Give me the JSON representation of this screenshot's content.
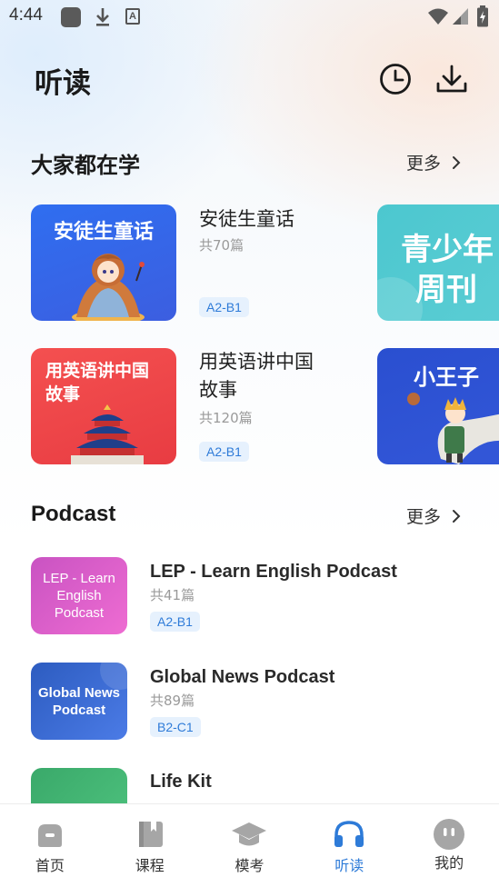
{
  "status_bar": {
    "time": "4:44",
    "icons": [
      "app-icon",
      "download-icon",
      "a-icon",
      "wifi-icon",
      "signal-icon",
      "battery-icon"
    ]
  },
  "header": {
    "title": "听读",
    "history_icon": "history-clock-icon",
    "download_icon": "download-icon"
  },
  "popular": {
    "title": "大家都在学",
    "more_label": "更多",
    "books": [
      {
        "cover_text": "安徒生童话",
        "title": "安徒生童话",
        "count": "共70篇",
        "level": "A2-B1"
      },
      {
        "cover_text": "用英语讲中国故事",
        "title_line1": "用英语讲中国",
        "title_line2": "故事",
        "count": "共120篇",
        "level": "A2-B1"
      }
    ],
    "partial_covers": [
      {
        "line1": "青少年",
        "line2": "周刊"
      },
      {
        "line1": "小王子"
      }
    ]
  },
  "podcast": {
    "title": "Podcast",
    "more_label": "更多",
    "items": [
      {
        "cover_line1": "LEP - Learn",
        "cover_line2": "English",
        "cover_line3": "Podcast",
        "title": "LEP - Learn English Podcast",
        "count": "共41篇",
        "level": "A2-B1"
      },
      {
        "cover_line1": "Global News",
        "cover_line2": "Podcast",
        "title": "Global News Podcast",
        "count": "共89篇",
        "level": "B2-C1"
      },
      {
        "title": "Life Kit"
      }
    ]
  },
  "bottom_nav": {
    "items": [
      {
        "label": "首页",
        "icon": "home-icon"
      },
      {
        "label": "课程",
        "icon": "book-icon"
      },
      {
        "label": "模考",
        "icon": "graduation-cap-icon"
      },
      {
        "label": "听读",
        "icon": "headphones-icon"
      },
      {
        "label": "我的",
        "icon": "profile-face-icon"
      }
    ],
    "active": "听读"
  },
  "colors": {
    "accent": "#2e7bd8",
    "active_nav": "#2e7bd8",
    "badge_bg": "#e6f1fd"
  }
}
